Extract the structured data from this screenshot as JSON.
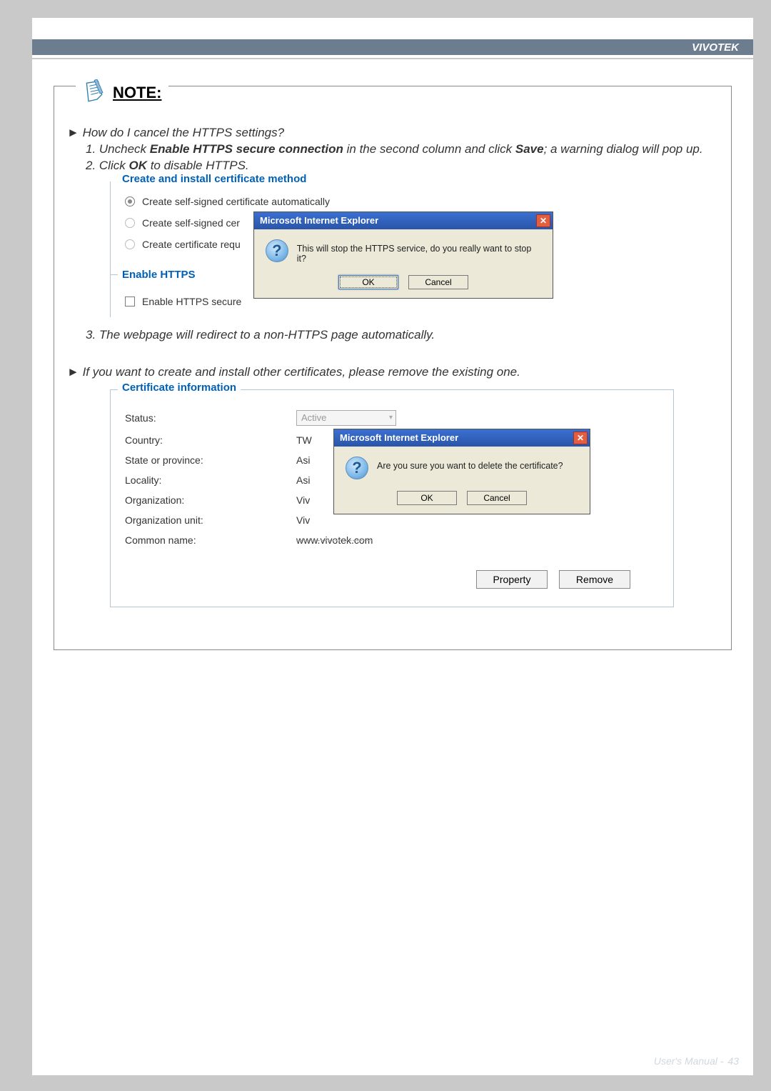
{
  "header": {
    "brand": "VIVOTEK"
  },
  "note": {
    "title": "NOTE:",
    "question1": "How do I cancel the HTTPS settings?",
    "step1_prefix": "1. Uncheck ",
    "step1_bold1": "Enable HTTPS secure connection",
    "step1_mid": " in the second column and click ",
    "step1_bold2": "Save",
    "step1_suffix": "; a warning dialog will pop up.",
    "step2_prefix": "2. Click ",
    "step2_bold": "OK",
    "step2_suffix": " to disable HTTPS.",
    "step3": "3. The webpage will redirect to a non-HTTPS page automatically.",
    "question2": "If you want to create and install other certificates, please remove the existing one."
  },
  "fieldset1": {
    "legend": "Create and install certificate method",
    "radio1": "Create self-signed certificate automatically",
    "radio2": "Create self-signed cer",
    "radio3": "Create certificate requ",
    "enable_label": "Enable HTTPS",
    "checkbox_label": "Enable HTTPS secure"
  },
  "dialog1": {
    "title": "Microsoft Internet Explorer",
    "message": "This will stop the HTTPS service, do you really want to stop it?",
    "ok": "OK",
    "cancel": "Cancel"
  },
  "fieldset2": {
    "legend": "Certificate information",
    "status_label": "Status:",
    "status_value": "Active",
    "country_label": "Country:",
    "country_value": "TW",
    "state_label": "State or province:",
    "state_value": "Asi",
    "locality_label": "Locality:",
    "locality_value": "Asi",
    "org_label": "Organization:",
    "org_value": "Viv",
    "org_unit_label": "Organization unit:",
    "org_unit_value": "Viv",
    "common_name_label": "Common name:",
    "common_name_value": "www.vivotek.com",
    "property_btn": "Property",
    "remove_btn": "Remove"
  },
  "dialog2": {
    "title": "Microsoft Internet Explorer",
    "message": "Are you sure you want to delete the certificate?",
    "ok": "OK",
    "cancel": "Cancel"
  },
  "footer": {
    "text": "User's Manual -",
    "page": "43"
  }
}
